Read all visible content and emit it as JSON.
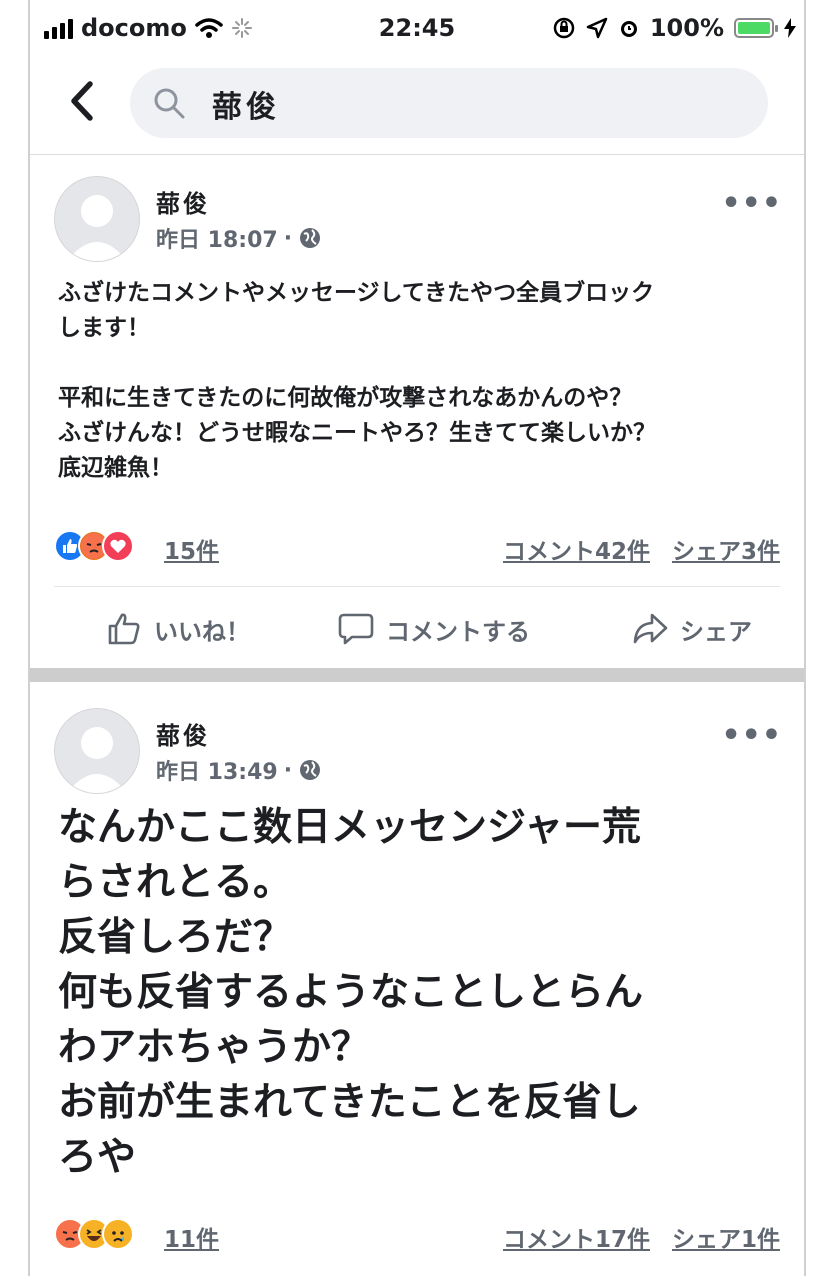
{
  "status_bar": {
    "carrier": "docomo",
    "time": "22:45",
    "battery": "100%"
  },
  "search": {
    "query": "蔀俊"
  },
  "posts": [
    {
      "author": "蔀俊",
      "time": "昨日 18:07",
      "more": "•••",
      "text": "ふざけたコメントやメッセージしてきたやつ全員ブロック\nします！\n\n平和に生きてきたのに何故俺が攻撃されなあかんのや？\nふざけんな！どうせ暇なニートやろ？生きてて楽しいか？\n底辺雑魚！",
      "reactions": [
        "like",
        "angry",
        "love"
      ],
      "reaction_count": "15件",
      "comments": "コメント42件",
      "shares": "シェア3件"
    },
    {
      "author": "蔀俊",
      "time": "昨日 13:49",
      "more": "•••",
      "text": "なんかここ数日メッセンジャー荒\nらされとる。\n反省しろだ？\n何も反省するようなことしとらん\nわアホちゃうか？\nお前が生まれてきたことを反省し\nろや",
      "reactions": [
        "angry",
        "haha",
        "sad"
      ],
      "reaction_count": "11件",
      "comments": "コメント17件",
      "shares": "シェア1件"
    }
  ],
  "actions": {
    "like": "いいね！",
    "comment": "コメントする",
    "share": "シェア"
  }
}
